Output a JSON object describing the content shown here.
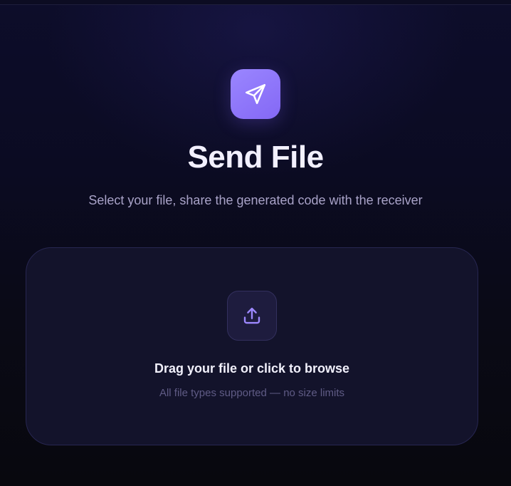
{
  "page": {
    "title": "Send File",
    "subtitle": "Select your file, share the generated code with the receiver"
  },
  "dropzone": {
    "title": "Drag your file or click to browse",
    "hint": "All file types supported — no size limits"
  },
  "icons": {
    "logo": "send-icon",
    "upload": "upload-icon"
  },
  "colors": {
    "accent": "#8b73fb",
    "background": "#0b0b1f",
    "card": "#13132b"
  }
}
